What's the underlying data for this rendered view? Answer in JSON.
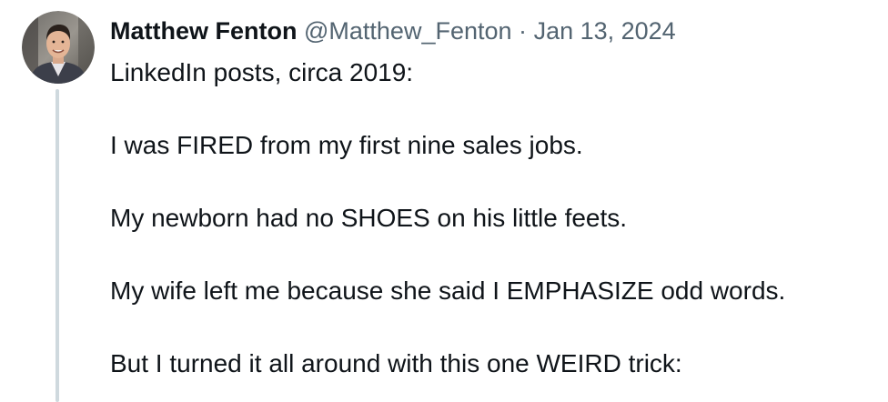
{
  "author": {
    "display_name": "Matthew Fenton",
    "handle": "@Matthew_Fenton",
    "separator": "·",
    "date": "Jan 13, 2024",
    "avatar_icon": "avatar-photo"
  },
  "post": {
    "lines": [
      "LinkedIn posts, circa 2019:",
      "I was FIRED from my first nine sales jobs.",
      "My newborn had no SHOES on his little feets.",
      "My wife left me because she said I EMPHASIZE odd words.",
      "But I turned it all around with this one WEIRD trick:"
    ]
  },
  "colors": {
    "text_primary": "#0f1419",
    "text_secondary": "#536471",
    "thread_line": "#cfd9de"
  }
}
